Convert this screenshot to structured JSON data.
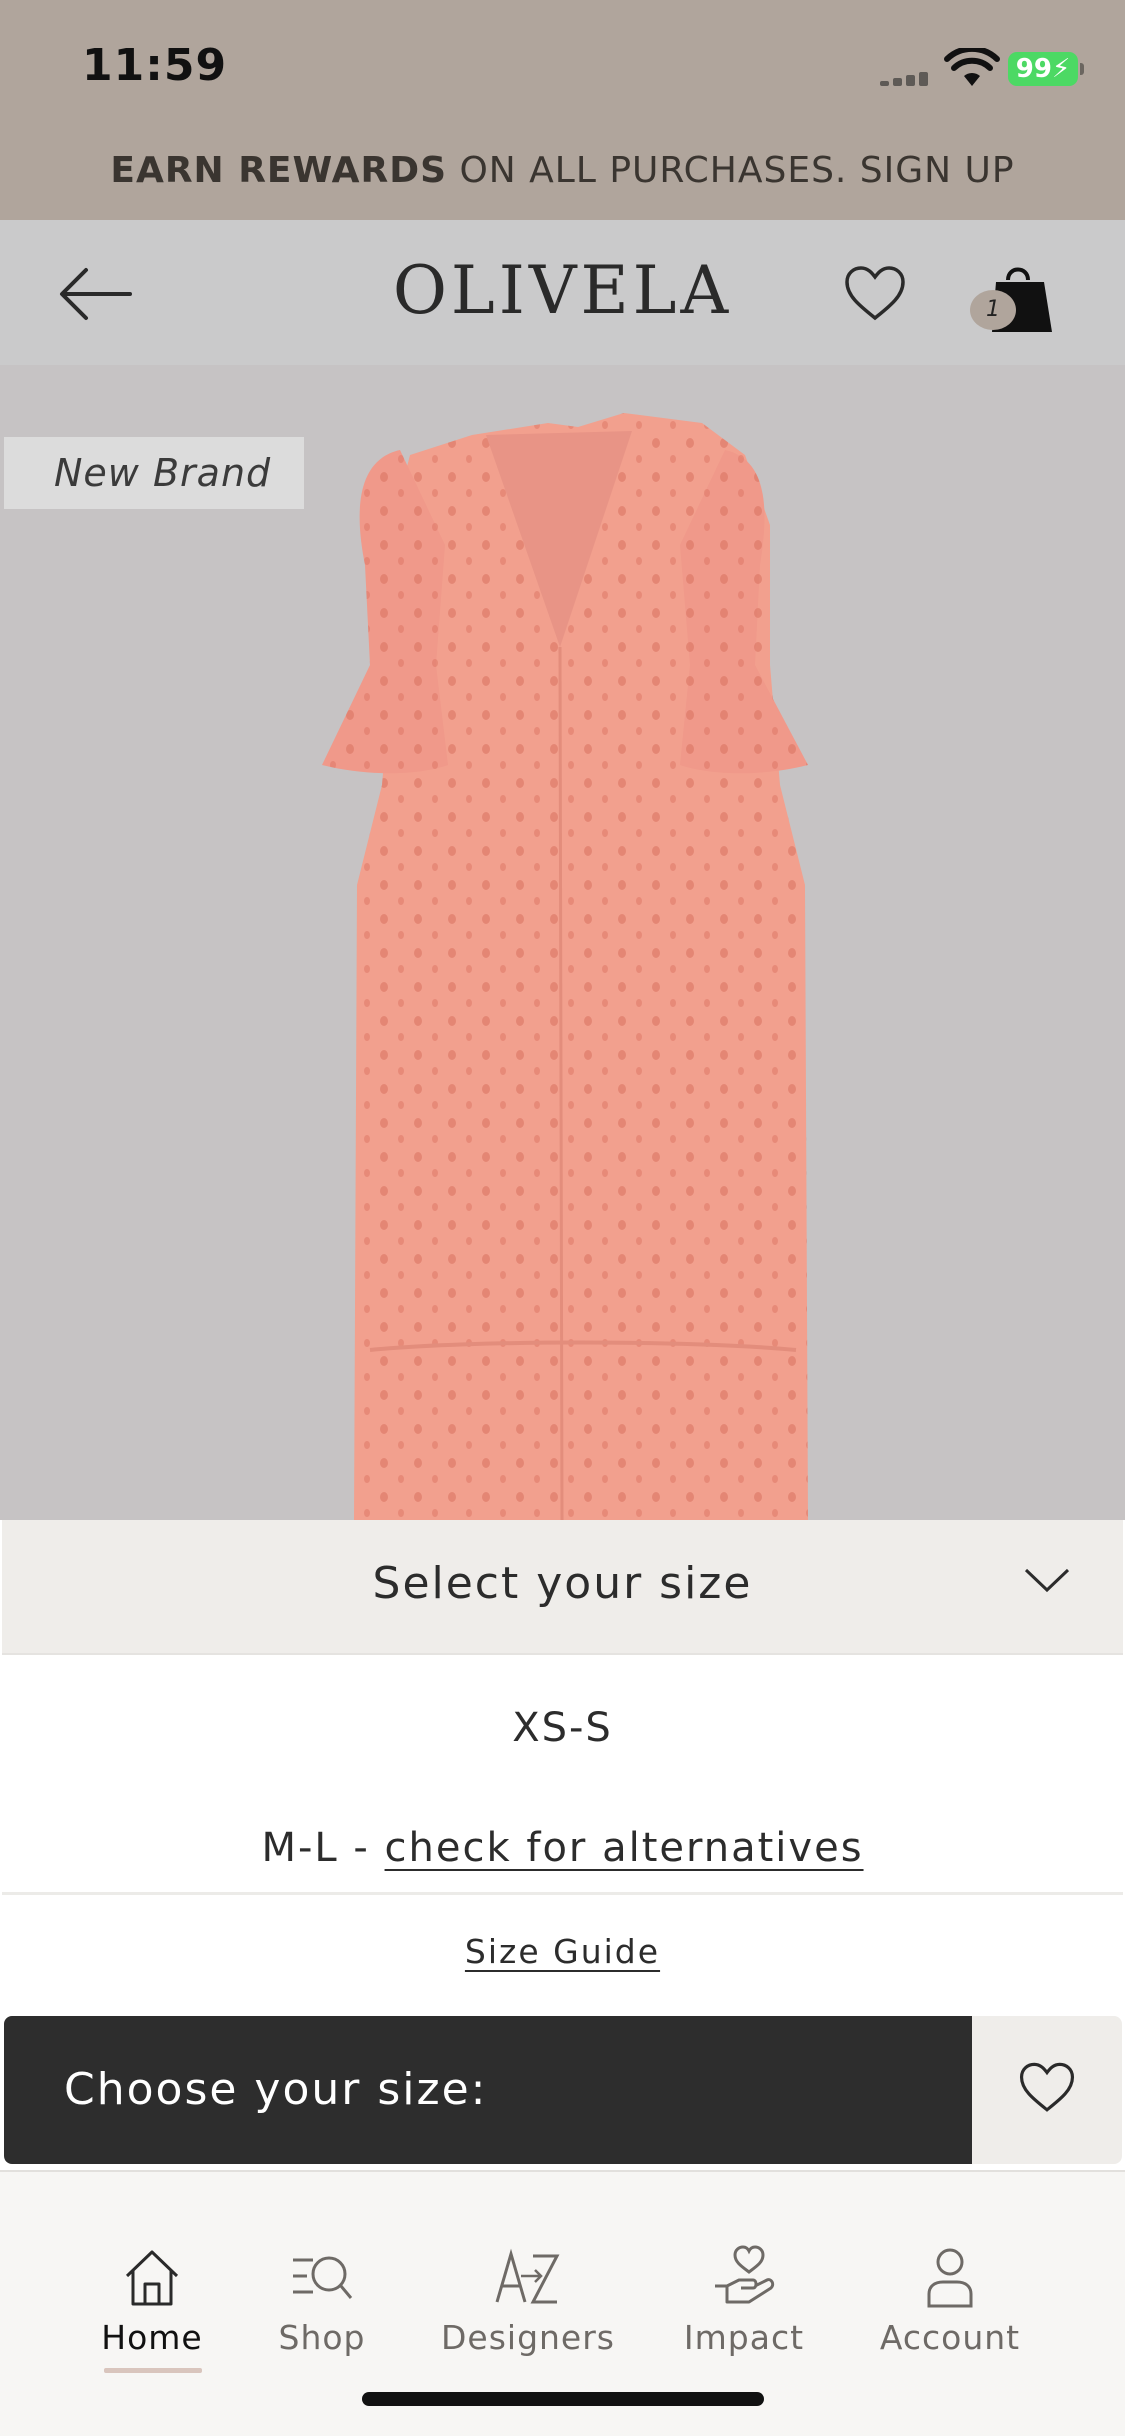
{
  "status_bar": {
    "time": "11:59",
    "battery": "99"
  },
  "promo": {
    "bold": "EARN REWARDS",
    "rest": " ON ALL PURCHASES. SIGN UP"
  },
  "header": {
    "logo": "OLIVELA",
    "bag_count": "1"
  },
  "product": {
    "badge": "New Brand",
    "dress_color": "#f2a08e"
  },
  "size_selector": {
    "title": "Select your size",
    "options": [
      {
        "label": "XS-S"
      },
      {
        "label": "M-L - ",
        "link": "check for alternatives"
      }
    ],
    "size_guide": "Size Guide"
  },
  "cta": {
    "label": "Choose your size:"
  },
  "tabbar": {
    "items": [
      {
        "label": "Home",
        "icon": "home-icon",
        "active": true
      },
      {
        "label": "Shop",
        "icon": "shop-search-icon",
        "active": false
      },
      {
        "label": "Designers",
        "icon": "designers-az-icon",
        "active": false
      },
      {
        "label": "Impact",
        "icon": "impact-heart-hand-icon",
        "active": false
      },
      {
        "label": "Account",
        "icon": "account-icon",
        "active": false
      }
    ]
  }
}
